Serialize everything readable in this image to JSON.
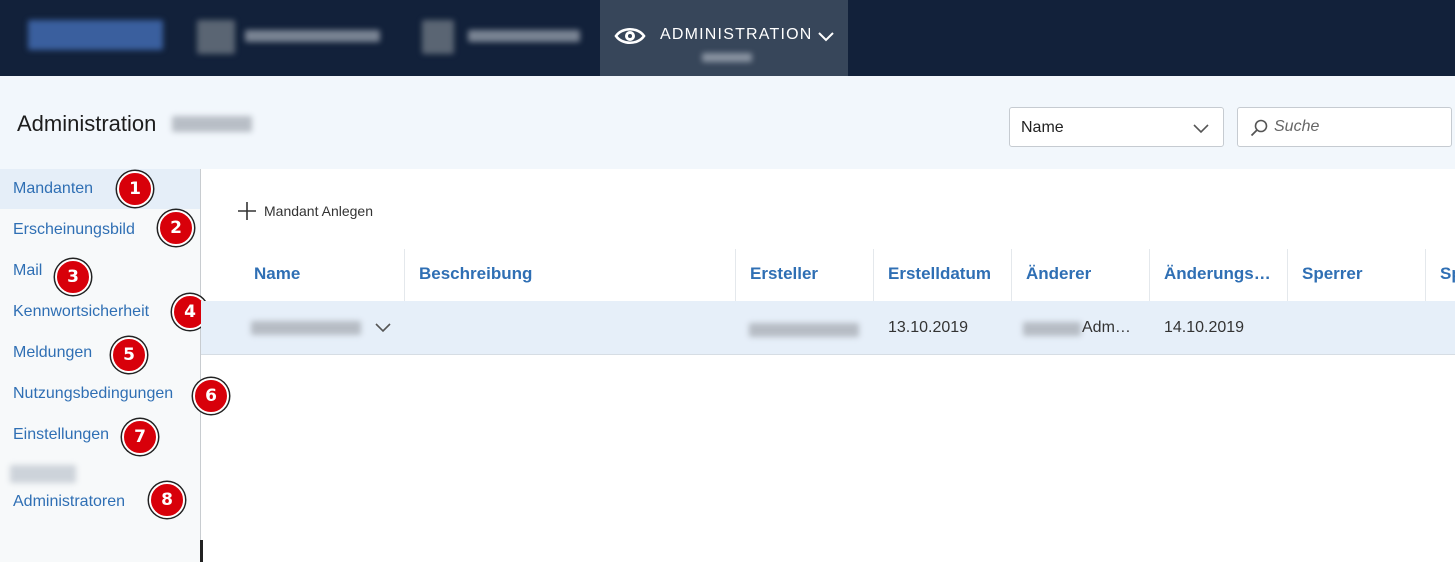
{
  "topnav": {
    "admin_label": "ADMINISTRATION"
  },
  "header": {
    "title": "Administration",
    "select_value": "Name",
    "search_placeholder": "Suche"
  },
  "sidebar": {
    "items": [
      {
        "label": "Mandanten",
        "badge": "1"
      },
      {
        "label": "Erscheinungsbild",
        "badge": "2"
      },
      {
        "label": "Mail",
        "badge": "3"
      },
      {
        "label": "Kennwortsicherheit",
        "badge": "4"
      },
      {
        "label": "Meldungen",
        "badge": "5"
      },
      {
        "label": "Nutzungsbedingungen",
        "badge": "6"
      },
      {
        "label": "Einstellungen",
        "badge": "7"
      },
      {
        "label": "Administratoren",
        "badge": "8"
      }
    ]
  },
  "main": {
    "add_label": "Mandant Anlegen",
    "columns": [
      "Name",
      "Beschreibung",
      "Ersteller",
      "Erstelldatum",
      "Änderer",
      "Änderungs…",
      "Sperrer",
      "Sp"
    ],
    "row": {
      "created": "13.10.2019",
      "modifier": "Adm…",
      "modified": "14.10.2019"
    }
  },
  "colors": {
    "nav_bg": "#12213a",
    "accent": "#3a78c2",
    "link": "#2f6fb4",
    "badge": "#d8000a"
  },
  "icons": [
    "eye-icon",
    "chevron-down-icon",
    "search-icon",
    "plus-icon"
  ]
}
